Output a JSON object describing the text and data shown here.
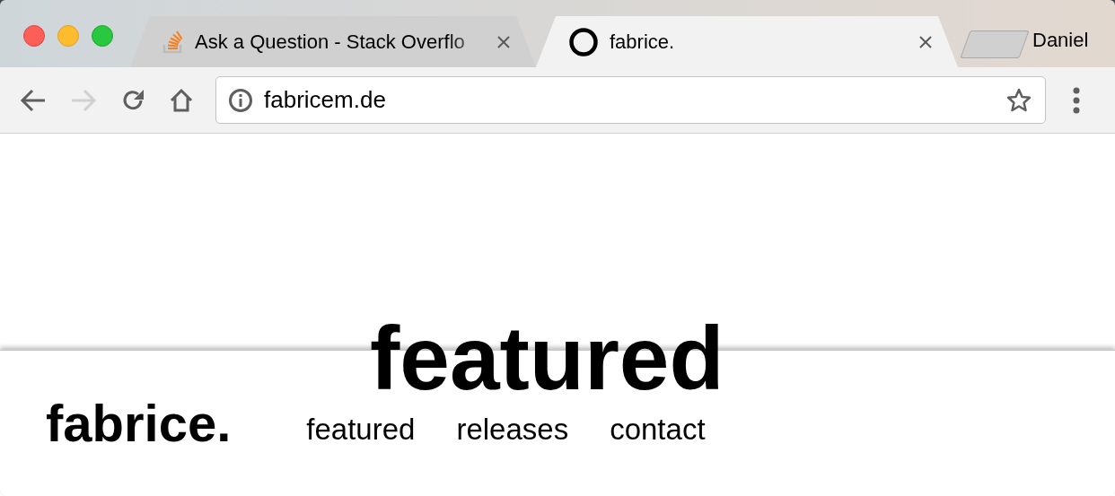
{
  "window": {
    "user": "Daniel"
  },
  "tabs": [
    {
      "title": "Ask a Question - Stack Overflo",
      "selected": false,
      "kind": "stack"
    },
    {
      "title": "fabrice.",
      "selected": true,
      "kind": "ring"
    }
  ],
  "toolbar": {
    "url": "fabricem.de",
    "forward_disabled": true
  },
  "page": {
    "heading": "featured",
    "logo": "fabrice.",
    "nav": [
      {
        "label": "featured"
      },
      {
        "label": "releases"
      },
      {
        "label": "contact"
      }
    ]
  }
}
